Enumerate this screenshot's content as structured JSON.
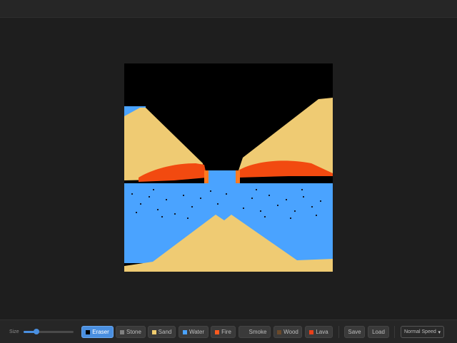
{
  "toolbar": {
    "size_label": "Size",
    "size_value": 0.25,
    "materials": [
      {
        "label": "Eraser",
        "color": "#000000",
        "active": true
      },
      {
        "label": "Stone",
        "color": "#808080",
        "active": false
      },
      {
        "label": "Sand",
        "color": "#f0cc6e",
        "active": false
      },
      {
        "label": "Water",
        "color": "#4aa3ff",
        "active": false
      },
      {
        "label": "Fire",
        "color": "#ff5a1f",
        "active": false
      },
      {
        "label": "Smoke",
        "color": "#3a3a3a",
        "active": false
      },
      {
        "label": "Wood",
        "color": "#6b4a2b",
        "active": false
      },
      {
        "label": "Lava",
        "color": "#e8401a",
        "active": false
      }
    ],
    "save_label": "Save",
    "load_label": "Load",
    "speed_selected": "Normal Speed"
  },
  "colors": {
    "sand": "#efcb73",
    "water": "#4aa3ff",
    "lava": "#f24a10",
    "lava_hot": "#ff7a20",
    "accent": "#4a8fe0"
  }
}
